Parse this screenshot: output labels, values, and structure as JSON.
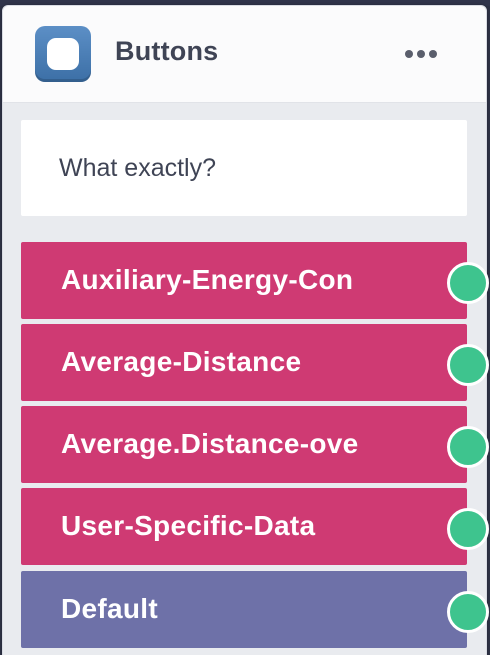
{
  "node": {
    "title": "Buttons",
    "icon": "node-square-icon",
    "menu_icon": "more-horizontal-icon",
    "prompt": "What exactly?",
    "buttons": [
      {
        "label": "Auxiliary-Energy-Con",
        "kind": "choice"
      },
      {
        "label": "Average-Distance",
        "kind": "choice"
      },
      {
        "label": "Average.Distance-ove",
        "kind": "choice"
      },
      {
        "label": "User-Specific-Data",
        "kind": "choice"
      },
      {
        "label": "Default",
        "kind": "default"
      }
    ]
  },
  "colors": {
    "choice_button": "#cf3a73",
    "default_button": "#6e71a8",
    "port": "#3ec48e",
    "icon": "#4a7db6",
    "title_text": "#3f4455"
  }
}
